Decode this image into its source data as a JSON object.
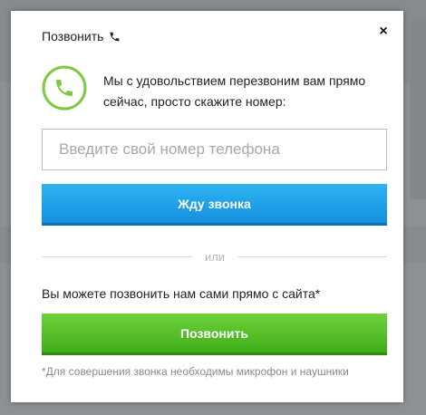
{
  "modal": {
    "title": "Позвонить",
    "title_icon": "phone-icon",
    "close_label": "×",
    "intro": "Мы с удовольствием перезвоним вам прямо сейчас, просто скажите номер:",
    "phone_input": {
      "placeholder": "Введите свой номер телефона",
      "value": ""
    },
    "callback_button": "Жду звонка",
    "divider": "или",
    "self_call_text": "Вы можете позвонить нам сами прямо с сайта*",
    "call_button": "Позвонить",
    "footnote": "*Для совершения звонка необходимы микрофон и наушники"
  },
  "colors": {
    "accent_blue": "#1b9ee8",
    "accent_green": "#4cbb22",
    "icon_green": "#7cc943"
  }
}
